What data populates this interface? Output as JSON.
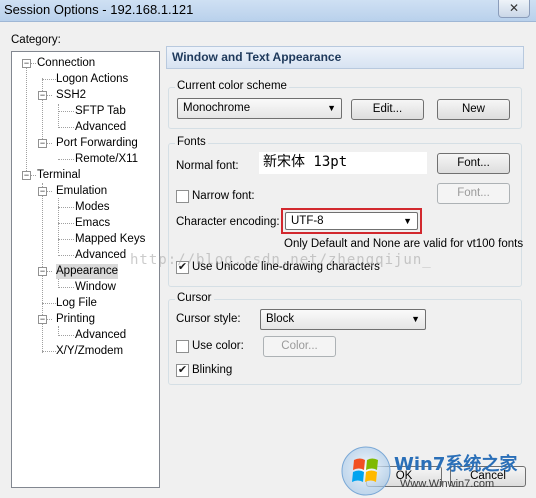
{
  "window": {
    "title": "Session Options - 192.168.1.121",
    "close_label": "✕"
  },
  "category_label": "Category:",
  "tree": [
    "Connection",
    "Logon Actions",
    "SSH2",
    "SFTP Tab",
    "Advanced",
    "Port Forwarding",
    "Remote/X11",
    "Terminal",
    "Emulation",
    "Modes",
    "Emacs",
    "Mapped Keys",
    "Advanced",
    "Appearance",
    "Window",
    "Log File",
    "Printing",
    "Advanced",
    "X/Y/Zmodem"
  ],
  "panel": {
    "header": "Window and Text Appearance",
    "color_scheme": {
      "title": "Current color scheme",
      "value": "Monochrome",
      "edit_button": "Edit...",
      "new_button": "New"
    },
    "fonts": {
      "title": "Fonts",
      "normal_label": "Normal font:",
      "normal_preview": "新宋体 13pt",
      "font_button": "Font...",
      "narrow_label": "Narrow font:",
      "narrow_font_button": "Font...",
      "encoding_label": "Character encoding:",
      "encoding_value": "UTF-8",
      "note": "Only Default and None are valid for vt100 fonts",
      "unicode_label": "Use Unicode line-drawing characters"
    },
    "cursor": {
      "title": "Cursor",
      "style_label": "Cursor style:",
      "style_value": "Block",
      "use_color_label": "Use color:",
      "color_button": "Color...",
      "blinking_label": "Blinking"
    }
  },
  "footer": {
    "ok_button": "OK",
    "cancel_button": "Cancel"
  },
  "watermark": "http://blog.csdn.net/zhengqijun_",
  "logo": {
    "brand_text": "Win7系统之家",
    "url": "Www.Winwin7.com"
  }
}
